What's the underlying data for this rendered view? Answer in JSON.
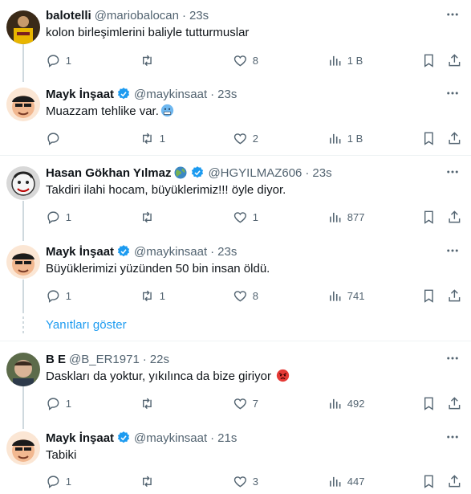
{
  "tweets": [
    {
      "name": "balotelli",
      "handle": "@mariobalocan",
      "time": "23s",
      "text": "kolon birleşimlerini baliyle tutturmuslar",
      "replies": "1",
      "retweets": "",
      "likes": "8",
      "views": "1 B"
    },
    {
      "name": "Mayk İnşaat",
      "handle": "@maykinsaat",
      "time": "23s",
      "text": "Muazzam tehlike var.",
      "replies": "",
      "retweets": "1",
      "likes": "2",
      "views": "1 B"
    },
    {
      "name": "Hasan Gökhan Yılmaz",
      "handle": "@HGYILMAZ606",
      "time": "23s",
      "text": "Takdiri ilahi hocam, büyüklerimiz!!! öyle diyor.",
      "replies": "1",
      "retweets": "",
      "likes": "1",
      "views": "877"
    },
    {
      "name": "Mayk İnşaat",
      "handle": "@maykinsaat",
      "time": "23s",
      "text": "Büyüklerimizi yüzünden 50 bin insan öldü.",
      "replies": "1",
      "retweets": "1",
      "likes": "8",
      "views": "741"
    },
    {
      "name": "B E",
      "handle": "@B_ER1971",
      "time": "22s",
      "text": "Daskları da yoktur, yıkılınca da bize giriyor",
      "replies": "1",
      "retweets": "",
      "likes": "7",
      "views": "492"
    },
    {
      "name": "Mayk İnşaat",
      "handle": "@maykinsaat",
      "time": "21s",
      "text": "Tabiki",
      "replies": "1",
      "retweets": "",
      "likes": "3",
      "views": "447"
    }
  ],
  "show_replies": "Yanıtları göster",
  "dot": "·",
  "icons": {
    "reply": "reply-icon",
    "retweet": "retweet-icon",
    "like": "heart-icon",
    "views": "views-icon",
    "bookmark": "bookmark-icon",
    "share": "share-icon",
    "more": "more-icon",
    "verified": "verified-icon"
  },
  "colors": {
    "accent": "#1d9bf0",
    "text": "#0f1419",
    "muted": "#536471",
    "divider": "#eff3f4"
  }
}
